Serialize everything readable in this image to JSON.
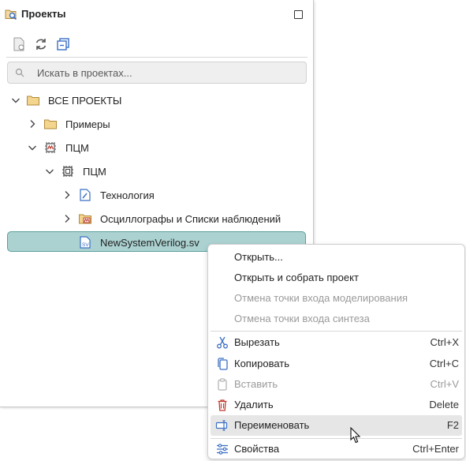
{
  "panel": {
    "title": "Проекты",
    "toolbar_icons": [
      "new-project-icon",
      "refresh-icon",
      "collapse-all-icon"
    ]
  },
  "search": {
    "placeholder": "Искать в проектах..."
  },
  "tree": [
    {
      "label": "ВСЕ ПРОЕКТЫ",
      "expanded": true,
      "icon": "folder-icon"
    },
    {
      "label": "Примеры",
      "expanded": false,
      "icon": "folder-icon"
    },
    {
      "label": "ПЦМ",
      "expanded": true,
      "icon": "chip-project-icon"
    },
    {
      "label": "ПЦМ",
      "expanded": true,
      "icon": "chip-icon"
    },
    {
      "label": "Технология",
      "expanded": false,
      "icon": "technology-file-icon"
    },
    {
      "label": "Осциллографы и Списки наблюдений",
      "expanded": false,
      "icon": "waveform-folder-icon"
    },
    {
      "label": "NewSystemVerilog.sv",
      "selected": true,
      "icon": "sv-file-icon"
    }
  ],
  "context_menu": {
    "items": [
      {
        "label": "Открыть...",
        "shortcut": "",
        "enabled": true
      },
      {
        "label": "Открыть и собрать проект",
        "shortcut": "",
        "enabled": true
      },
      {
        "label": "Отмена точки входа моделирования",
        "shortcut": "",
        "enabled": false
      },
      {
        "label": "Отмена точки входа синтеза",
        "shortcut": "",
        "enabled": false
      },
      {
        "label": "Вырезать",
        "shortcut": "Ctrl+X",
        "enabled": true,
        "icon": "scissors-icon"
      },
      {
        "label": "Копировать",
        "shortcut": "Ctrl+C",
        "enabled": true,
        "icon": "copy-icon"
      },
      {
        "label": "Вставить",
        "shortcut": "Ctrl+V",
        "enabled": false,
        "icon": "paste-icon"
      },
      {
        "label": "Удалить",
        "shortcut": "Delete",
        "enabled": true,
        "icon": "trash-icon"
      },
      {
        "label": "Переименовать",
        "shortcut": "F2",
        "enabled": true,
        "icon": "rename-icon",
        "hovered": true
      },
      {
        "label": "Свойства",
        "shortcut": "Ctrl+Enter",
        "enabled": true,
        "icon": "properties-icon"
      }
    ]
  },
  "colors": {
    "selection_bg": "#abd2d1",
    "selection_border": "#5a9f9d",
    "folder": "#e9c46a",
    "accent_blue": "#3b6fc4",
    "delete_red": "#c0392b"
  }
}
